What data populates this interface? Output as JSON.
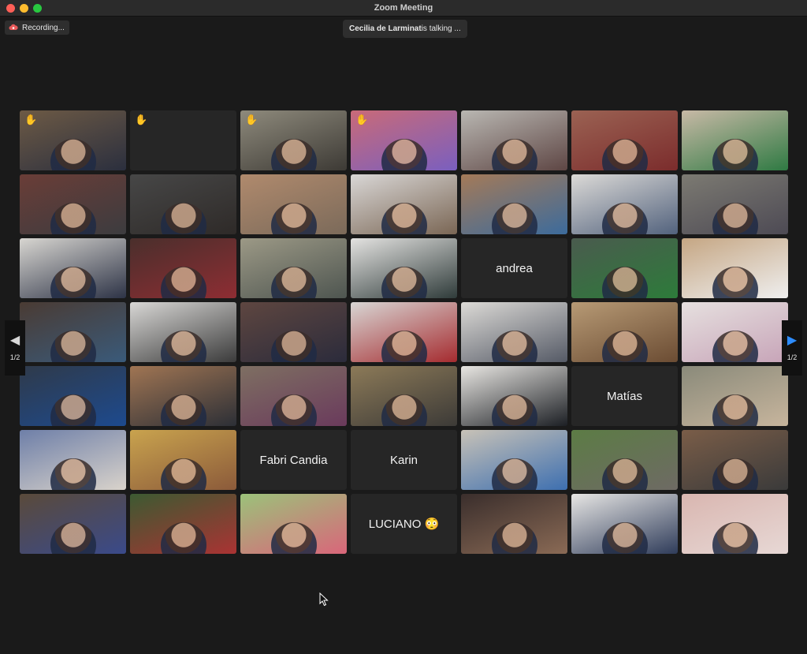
{
  "window": {
    "title": "Zoom Meeting"
  },
  "recording": {
    "label": "Recording...",
    "icon": "cloud-recording-icon"
  },
  "active_speaker": {
    "name": "Cecilia de Larminat",
    "suffix": " is talking ..."
  },
  "gallery": {
    "page": "1/2",
    "tiles": [
      {
        "type": "video",
        "hand": true,
        "c1": "#6d5a45",
        "c2": "#2b2f3e"
      },
      {
        "type": "off",
        "hand": true,
        "label": ""
      },
      {
        "type": "video",
        "hand": true,
        "c1": "#8e8a7c",
        "c2": "#3d3a35"
      },
      {
        "type": "video",
        "hand": true,
        "c1": "#c96a78",
        "c2": "#7a5fbf"
      },
      {
        "type": "video",
        "c1": "#b9b7b2",
        "c2": "#5e4644"
      },
      {
        "type": "video",
        "c1": "#9b6253",
        "c2": "#7b2c2c"
      },
      {
        "type": "video",
        "c1": "#c8b9a6",
        "c2": "#2f7a43"
      },
      {
        "type": "video",
        "c1": "#6a3d37",
        "c2": "#3c3c3f"
      },
      {
        "type": "video",
        "c1": "#474747",
        "c2": "#2e2a28"
      },
      {
        "type": "video",
        "c1": "#b08a6d",
        "c2": "#7b6a5a"
      },
      {
        "type": "video",
        "c1": "#d9d7d6",
        "c2": "#7a6654"
      },
      {
        "type": "video",
        "c1": "#a47a58",
        "c2": "#3c6b9c"
      },
      {
        "type": "video",
        "c1": "#dcdad7",
        "c2": "#52627d"
      },
      {
        "type": "video",
        "c1": "#7c7a72",
        "c2": "#4d4a54"
      },
      {
        "type": "video",
        "c1": "#d8d6d1",
        "c2": "#2d3346"
      },
      {
        "type": "video",
        "c1": "#4a2f2c",
        "c2": "#8e2d33"
      },
      {
        "type": "video",
        "c1": "#9c9986",
        "c2": "#4e5550"
      },
      {
        "type": "video",
        "c1": "#e4e3e1",
        "c2": "#2f3b3a"
      },
      {
        "type": "off",
        "label": "andrea"
      },
      {
        "type": "video",
        "c1": "#4a5b4e",
        "c2": "#2d7b3a"
      },
      {
        "type": "video",
        "c1": "#c5a683",
        "c2": "#efefef"
      },
      {
        "type": "video",
        "c1": "#4a3b33",
        "c2": "#3a5a7a"
      },
      {
        "type": "video",
        "c1": "#d8d7d5",
        "c2": "#3b3b3b"
      },
      {
        "type": "video",
        "c1": "#5e4640",
        "c2": "#2b2b3b"
      },
      {
        "type": "video",
        "c1": "#d8d6d4",
        "c2": "#a52b2f"
      },
      {
        "type": "video",
        "c1": "#dcdad6",
        "c2": "#555a66"
      },
      {
        "type": "video",
        "c1": "#b79a75",
        "c2": "#6b4c33"
      },
      {
        "type": "video",
        "c1": "#e6e0df",
        "c2": "#c7a4b8"
      },
      {
        "type": "video",
        "c1": "#2f3a4a",
        "c2": "#1d4a8e"
      },
      {
        "type": "video",
        "c1": "#a07553",
        "c2": "#2c2f36"
      },
      {
        "type": "video",
        "c1": "#7e6f62",
        "c2": "#6a3a5c"
      },
      {
        "type": "video",
        "c1": "#8c7a58",
        "c2": "#3c3a37"
      },
      {
        "type": "video",
        "c1": "#e8e6e2",
        "c2": "#1c1f24"
      },
      {
        "type": "off",
        "label": "Matías"
      },
      {
        "type": "video",
        "c1": "#8a8a7a",
        "c2": "#c7b59d"
      },
      {
        "type": "video",
        "c1": "#6e7fa8",
        "c2": "#d9d3cb"
      },
      {
        "type": "video",
        "c1": "#c9a34e",
        "c2": "#8b5a3a"
      },
      {
        "type": "off",
        "label": "Fabri Candia"
      },
      {
        "type": "off",
        "label": "Karin"
      },
      {
        "type": "video",
        "c1": "#c8c2b7",
        "c2": "#3d6fb0"
      },
      {
        "type": "video",
        "c1": "#5c7c45",
        "c2": "#6e6a64"
      },
      {
        "type": "video",
        "c1": "#7a5d48",
        "c2": "#3a3a3a"
      },
      {
        "type": "video",
        "c1": "#5a4a3a",
        "c2": "#3a4a8a"
      },
      {
        "type": "video",
        "c1": "#3c5a32",
        "c2": "#a33"
      },
      {
        "type": "video",
        "c1": "#9bc27a",
        "c2": "#d9667a"
      },
      {
        "type": "off",
        "label": "LUCIANO 😳"
      },
      {
        "type": "video",
        "c1": "#3a2e2c",
        "c2": "#8a6a55"
      },
      {
        "type": "video",
        "c1": "#e7e6e4",
        "c2": "#2f3c5a"
      },
      {
        "type": "video",
        "c1": "#d9b6b0",
        "c2": "#e7d8d5"
      }
    ]
  }
}
